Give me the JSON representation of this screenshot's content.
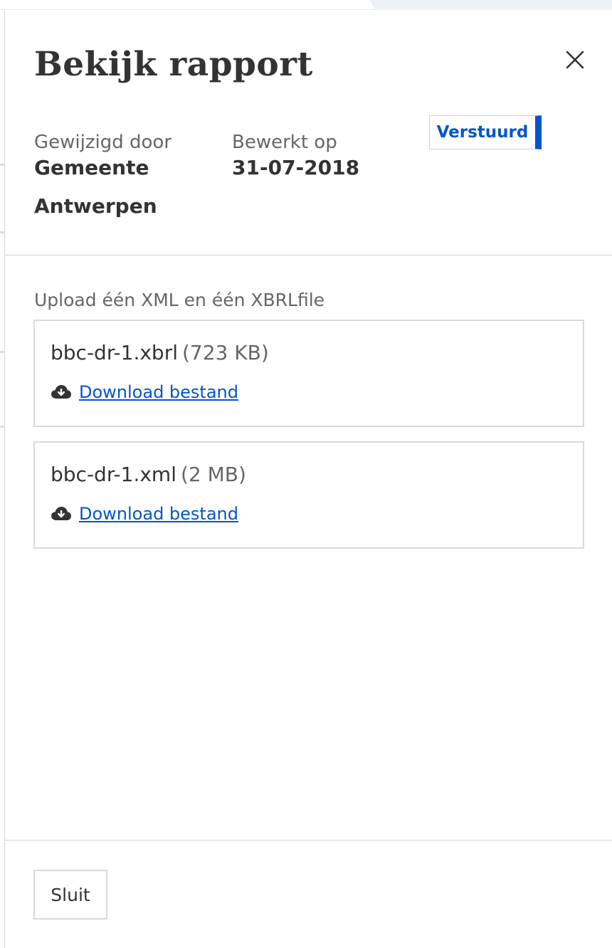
{
  "modal": {
    "title": "Bekijk rapport",
    "close_icon": "close-icon"
  },
  "meta": {
    "modified_by_label": "Gewijzigd door",
    "modified_by_value_line1": "Gemeente",
    "modified_by_value_line2": "Antwerpen",
    "edited_on_label": "Bewerkt op",
    "edited_on_value": "31-07-2018",
    "status": "Verstuurd",
    "status_color": "#0055cc"
  },
  "upload": {
    "label": "Upload één XML en één XBRLfile",
    "files": [
      {
        "name": "bbc-dr-1.xbrl",
        "size": "(723 KB)",
        "link": "Download bestand",
        "icon": "cloud-download-icon"
      },
      {
        "name": "bbc-dr-1.xml",
        "size": "(2 MB)",
        "link": "Download bestand",
        "icon": "cloud-download-icon"
      }
    ]
  },
  "footer": {
    "close_label": "Sluit"
  },
  "colors": {
    "accent": "#0055cc",
    "text": "#333332",
    "muted": "#666666",
    "border": "#cbd2da"
  }
}
